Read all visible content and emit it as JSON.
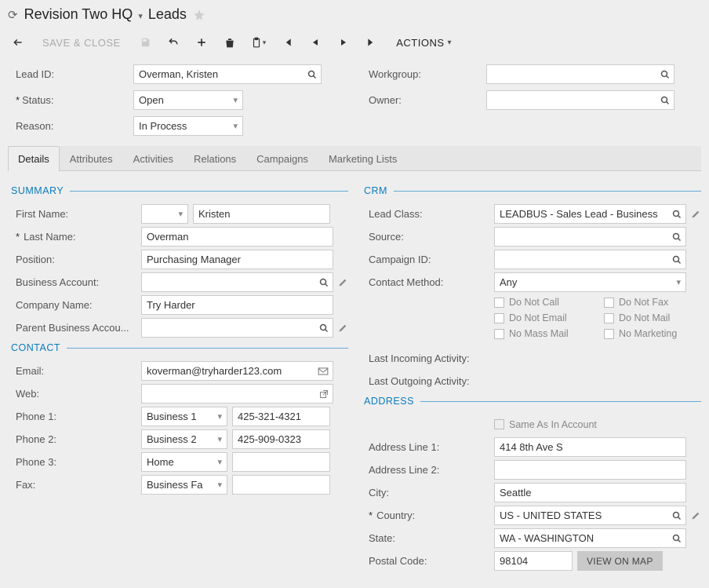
{
  "header": {
    "company": "Revision Two HQ",
    "page": "Leads"
  },
  "toolbar": {
    "save_close": "SAVE & CLOSE",
    "actions": "ACTIONS"
  },
  "top_form": {
    "lead_id_label": "Lead ID:",
    "lead_id_value": "Overman, Kristen",
    "status_label": "Status:",
    "status_value": "Open",
    "reason_label": "Reason:",
    "reason_value": "In Process",
    "workgroup_label": "Workgroup:",
    "workgroup_value": "",
    "owner_label": "Owner:",
    "owner_value": ""
  },
  "tabs": [
    "Details",
    "Attributes",
    "Activities",
    "Relations",
    "Campaigns",
    "Marketing Lists"
  ],
  "summary": {
    "title": "SUMMARY",
    "first_name_label": "First Name:",
    "first_name_value": "Kristen",
    "last_name_label": "Last Name:",
    "last_name_value": "Overman",
    "position_label": "Position:",
    "position_value": "Purchasing Manager",
    "business_account_label": "Business Account:",
    "business_account_value": "",
    "company_label": "Company Name:",
    "company_value": "Try Harder",
    "parent_ba_label": "Parent Business Accou...",
    "parent_ba_value": ""
  },
  "contact": {
    "title": "CONTACT",
    "email_label": "Email:",
    "email_value": "koverman@tryharder123.com",
    "web_label": "Web:",
    "web_value": "",
    "phone1_label": "Phone 1:",
    "phone1_type": "Business 1",
    "phone1_num": "425-321-4321",
    "phone2_label": "Phone 2:",
    "phone2_type": "Business 2",
    "phone2_num": "425-909-0323",
    "phone3_label": "Phone 3:",
    "phone3_type": "Home",
    "phone3_num": "",
    "fax_label": "Fax:",
    "fax_type": "Business Fa",
    "fax_num": ""
  },
  "crm": {
    "title": "CRM",
    "lead_class_label": "Lead Class:",
    "lead_class_value": "LEADBUS - Sales Lead - Business",
    "source_label": "Source:",
    "source_value": "",
    "campaign_label": "Campaign ID:",
    "campaign_value": "",
    "contact_method_label": "Contact Method:",
    "contact_method_value": "Any",
    "chk_dnc": "Do Not Call",
    "chk_dnf": "Do Not Fax",
    "chk_dne": "Do Not Email",
    "chk_dnm": "Do Not Mail",
    "chk_nmm": "No Mass Mail",
    "chk_nmk": "No Marketing",
    "last_in_label": "Last Incoming Activity:",
    "last_out_label": "Last Outgoing Activity:"
  },
  "address": {
    "title": "ADDRESS",
    "same_label": "Same As In Account",
    "line1_label": "Address Line 1:",
    "line1_value": "414 8th Ave S",
    "line2_label": "Address Line 2:",
    "line2_value": "",
    "city_label": "City:",
    "city_value": "Seattle",
    "country_label": "Country:",
    "country_value": "US - UNITED STATES",
    "state_label": "State:",
    "state_value": "WA - WASHINGTON",
    "postal_label": "Postal Code:",
    "postal_value": "98104",
    "view_map": "VIEW ON MAP"
  }
}
